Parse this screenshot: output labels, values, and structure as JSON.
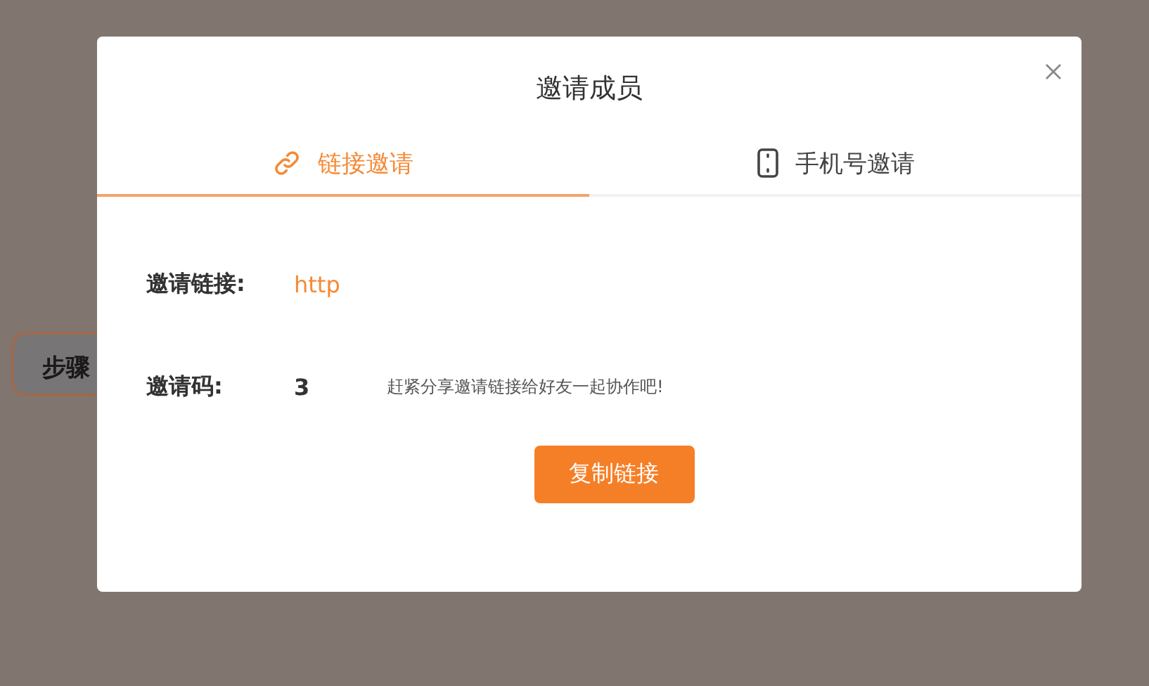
{
  "background": {
    "step_label": "步骤"
  },
  "dialog": {
    "title": "邀请成员",
    "tabs": [
      {
        "label": "链接邀请",
        "kind": "link",
        "selected": true
      },
      {
        "label": "手机号邀请",
        "kind": "phone",
        "selected": false
      }
    ],
    "fields": [
      {
        "label": "邀请链接:",
        "kind": "link",
        "value": "http"
      },
      {
        "label": "邀请码:",
        "kind": "code",
        "value": "3",
        "hint": "赶紧分享邀请链接给好友一起协作吧!"
      }
    ],
    "button": "复制链接"
  }
}
